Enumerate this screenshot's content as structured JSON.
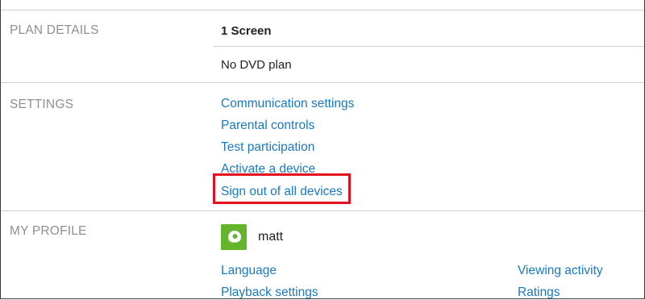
{
  "plan_details": {
    "title": "PLAN DETAILS",
    "plan": "1 Screen",
    "dvd": "No DVD plan"
  },
  "settings": {
    "title": "SETTINGS",
    "links": [
      "Communication settings",
      "Parental controls",
      "Test participation",
      "Activate a device",
      "Sign out of all devices"
    ],
    "highlighted": "Sign out of all devices",
    "highlight_color": "#e5101d"
  },
  "my_profile": {
    "title": "MY PROFILE",
    "name": "matt",
    "avatar_color": "#64b42b",
    "links_left": [
      "Language",
      "Playback settings"
    ],
    "links_right": [
      "Viewing activity",
      "Ratings"
    ]
  },
  "colors": {
    "link": "#1a78c2",
    "section_title": "#8f8f8f",
    "divider": "#cfcfcf"
  }
}
